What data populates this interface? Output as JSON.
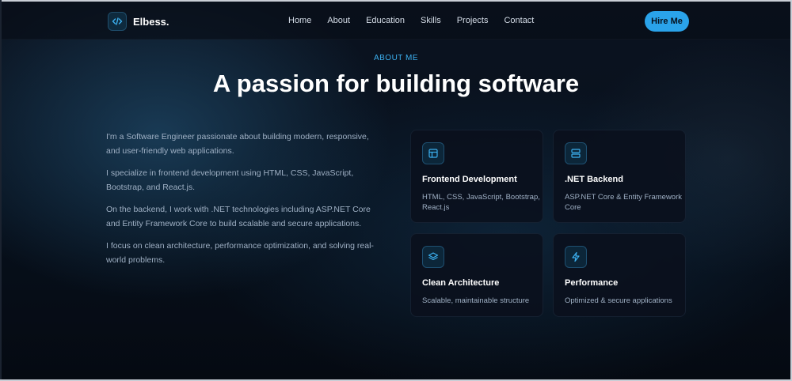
{
  "brand": {
    "name": "Elbess.",
    "logo_icon": "code-icon"
  },
  "nav": {
    "items": [
      "Home",
      "About",
      "Education",
      "Skills",
      "Projects",
      "Contact"
    ],
    "cta": "Hire Me"
  },
  "about": {
    "eyebrow": "ABOUT ME",
    "title": "A passion for building software",
    "paragraphs": [
      "I'm a Software Engineer passionate about building modern, responsive, and user-friendly web applications.",
      "I specialize in frontend development using HTML, CSS, JavaScript, Bootstrap, and React.js.",
      "On the backend, I work with .NET technologies including ASP.NET Core and Entity Framework Core to build scalable and secure applications.",
      "I focus on clean architecture, performance optimization, and solving real-world problems."
    ]
  },
  "cards": [
    {
      "icon": "layout-icon",
      "title": "Frontend Development",
      "desc": "HTML, CSS, JavaScript, Bootstrap, React.js"
    },
    {
      "icon": "server-icon",
      "title": ".NET Backend",
      "desc": "ASP.NET Core & Entity Framework Core"
    },
    {
      "icon": "layers-icon",
      "title": "Clean Architecture",
      "desc": "Scalable, maintainable structure"
    },
    {
      "icon": "bolt-icon",
      "title": "Performance",
      "desc": "Optimized & secure applications"
    }
  ],
  "colors": {
    "accent": "#2aa3ea",
    "background": "#070b14"
  }
}
